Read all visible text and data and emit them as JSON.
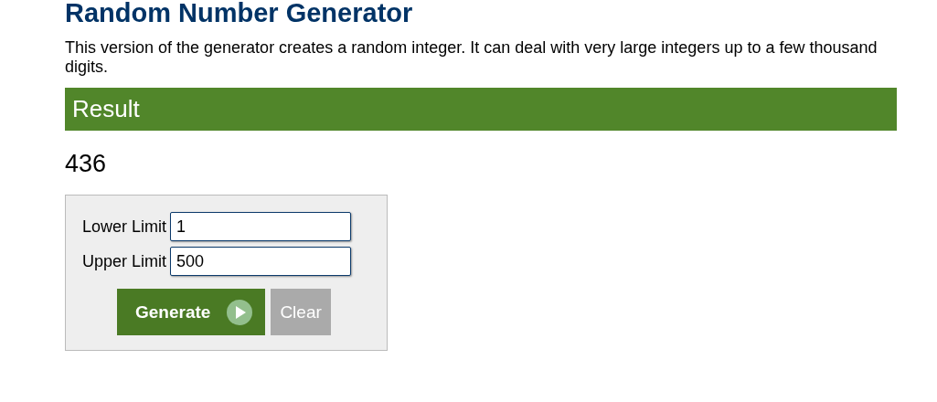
{
  "title": "Random Number Generator",
  "description": "This version of the generator creates a random integer. It can deal with very large integers up to a few thousand digits.",
  "result_header": "Result",
  "result": "436",
  "form": {
    "fields": [
      {
        "label": "Lower Limit",
        "value": "1"
      },
      {
        "label": "Upper Limit",
        "value": "500"
      }
    ],
    "buttons": [
      {
        "kind": "primary",
        "label": "Generate"
      },
      {
        "kind": "secondary",
        "label": "Clear"
      }
    ]
  }
}
